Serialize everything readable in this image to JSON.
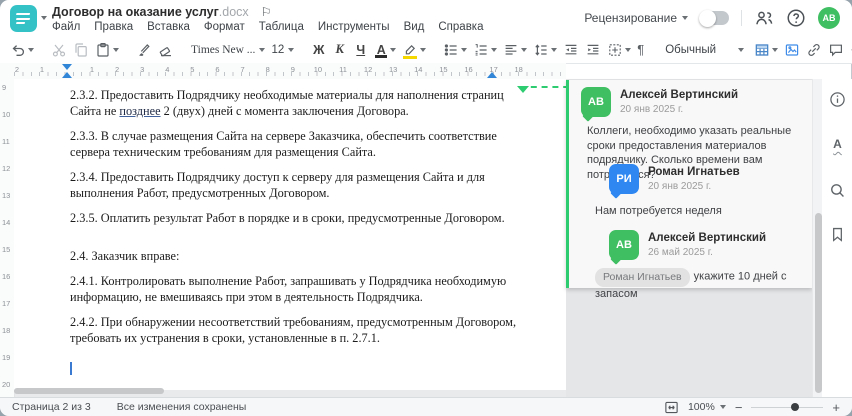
{
  "header": {
    "title": "Договор на оказание услуг",
    "title_ext": ".docx",
    "flag_icon": "⚐",
    "menu": [
      "Файл",
      "Правка",
      "Вставка",
      "Формат",
      "Таблица",
      "Инструменты",
      "Вид",
      "Справка"
    ],
    "review_label": "Рецензирование",
    "review_toggle_state": "off",
    "avatar_initials": "АВ"
  },
  "toolbar": {
    "font_name": "Times New ...",
    "font_size": "12",
    "bold_label": "Ж",
    "italic_label": "К",
    "underline_label": "Ч",
    "font_color_label": "А",
    "pilcrow": "¶",
    "style_name": "Обычный",
    "more_label": "⋯"
  },
  "ruler": {
    "left_numbers": [
      "2",
      "1"
    ],
    "numbers": [
      "1",
      "2",
      "3",
      "4",
      "5",
      "6",
      "7",
      "8",
      "9",
      "10",
      "11",
      "12",
      "13",
      "14",
      "15",
      "16",
      "17",
      "18"
    ],
    "vertical_numbers": [
      "9",
      "10",
      "11",
      "12",
      "13",
      "14",
      "15",
      "16",
      "17",
      "18",
      "19",
      "20"
    ]
  },
  "document": {
    "p1_pre": "2.3.2. Предоставить Подрядчику необходимые материалы для наполнения страниц Сайта не ",
    "p1_marked": "позднее",
    "p1_post": " 2 (двух) дней с момента заключения Договора.",
    "p2": "2.3.3. В случае размещения Сайта на сервере Заказчика, обеспечить соответствие сервера техническим требованиям для размещения Сайта.",
    "p3": "2.3.4. Предоставить Подрядчику доступ к серверу для размещения Сайта и для выполнения Работ, предусмотренных Договором.",
    "p4": "2.3.5. Оплатить результат Работ в порядке и в сроки, предусмотренные Договором.",
    "p5": "2.4. Заказчик вправе:",
    "p6": "2.4.1. Контролировать выполнение Работ, запрашивать у Подрядчика необходимую информацию, не вмешиваясь при этом в деятельность Подрядчика.",
    "p7": "2.4.2. При обнаружении несоответствий требованиям, предусмотренным Договором, требовать их устранения в сроки, установленные в п. 2.7.1."
  },
  "comments": {
    "c1": {
      "initials": "АВ",
      "name": "Алексей Вертинский",
      "date": "20 янв 2025 г.",
      "text": "Коллеги, необходимо указать реальные сроки предоставления материалов подрядчику. Сколько времени вам потребуется?"
    },
    "c2": {
      "initials": "РИ",
      "name": "Роман Игнатьев",
      "date": "20 янв 2025 г.",
      "text": "Нам потребуется неделя"
    },
    "c3": {
      "initials": "АВ",
      "name": "Алексей Вертинский",
      "date": "26 май 2025 г.",
      "mention": "Роман Игнатьев",
      "text": "укажите 10 дней с запасом"
    }
  },
  "status_bar": {
    "page_info": "Страница 2 из 3",
    "save_status": "Все изменения сохранены",
    "zoom_value": "100%",
    "zoom_out": "−",
    "zoom_in": "+"
  },
  "colors": {
    "accent_teal": "#35c2c6",
    "avatar_green": "#3fbe62",
    "avatar_blue": "#2f88f2",
    "comment_anchor_green": "#2ecc71",
    "media_icon_blue": "#3f8ce8",
    "ruler_marker_blue": "#3186d8"
  }
}
